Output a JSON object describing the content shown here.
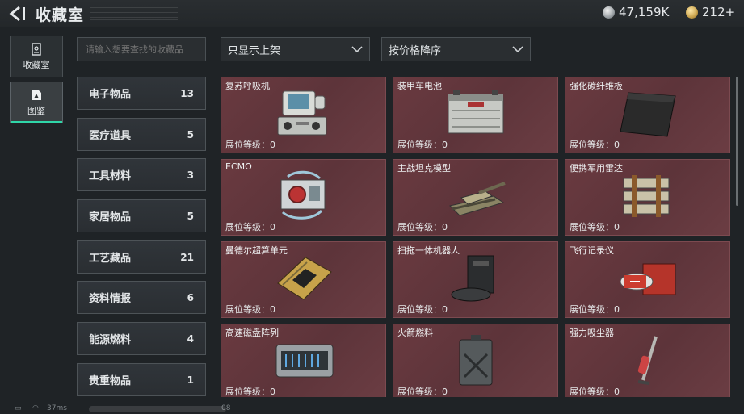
{
  "header": {
    "title": "收藏室",
    "currencies": [
      {
        "icon": "silver-coin-icon",
        "value": "47,159K"
      },
      {
        "icon": "gold-coin-icon",
        "value": "212+"
      }
    ]
  },
  "left_nav": [
    {
      "label": "收藏室",
      "icon": "collection-room-icon",
      "active": false
    },
    {
      "label": "图鉴",
      "icon": "codex-icon",
      "active": true
    }
  ],
  "search": {
    "placeholder": "请输入想要查找的收藏品"
  },
  "filters": {
    "display": "只显示上架",
    "sort": "按价格降序"
  },
  "categories": [
    {
      "label": "电子物品",
      "count": "13"
    },
    {
      "label": "医疗道具",
      "count": "5"
    },
    {
      "label": "工具材料",
      "count": "3"
    },
    {
      "label": "家居物品",
      "count": "5"
    },
    {
      "label": "工艺藏品",
      "count": "21"
    },
    {
      "label": "资料情报",
      "count": "6"
    },
    {
      "label": "能源燃料",
      "count": "4"
    },
    {
      "label": "贵重物品",
      "count": "1"
    }
  ],
  "items": [
    {
      "name": "复苏呼吸机",
      "level": "展位等级：0",
      "icon": "ventilator-icon"
    },
    {
      "name": "装甲车电池",
      "level": "展位等级：0",
      "icon": "vehicle-battery-icon"
    },
    {
      "name": "强化碳纤维板",
      "level": "展位等级：0",
      "icon": "carbon-plate-icon"
    },
    {
      "name": "ECMO",
      "level": "展位等级：0",
      "icon": "ecmo-icon"
    },
    {
      "name": "主战坦克模型",
      "level": "展位等级：0",
      "icon": "tank-model-icon"
    },
    {
      "name": "便携军用雷达",
      "level": "展位等级：0",
      "icon": "radar-icon"
    },
    {
      "name": "曼德尔超算单元",
      "level": "展位等级：0",
      "icon": "supercomputer-icon"
    },
    {
      "name": "扫拖一体机器人",
      "level": "展位等级：0",
      "icon": "robot-vacuum-icon"
    },
    {
      "name": "飞行记录仪",
      "level": "展位等级：0",
      "icon": "flight-recorder-icon"
    },
    {
      "name": "高速磁盘阵列",
      "level": "展位等级：0",
      "icon": "disk-array-icon"
    },
    {
      "name": "火箭燃料",
      "level": "展位等级：0",
      "icon": "fuel-can-icon"
    },
    {
      "name": "强力吸尘器",
      "level": "展位等级：0",
      "icon": "vacuum-icon"
    }
  ],
  "status": {
    "ping": "37ms",
    "right": "08"
  },
  "colors": {
    "card_bg": "#6a3a40",
    "accent": "#2fd6a8",
    "panel": "#1f2326"
  }
}
